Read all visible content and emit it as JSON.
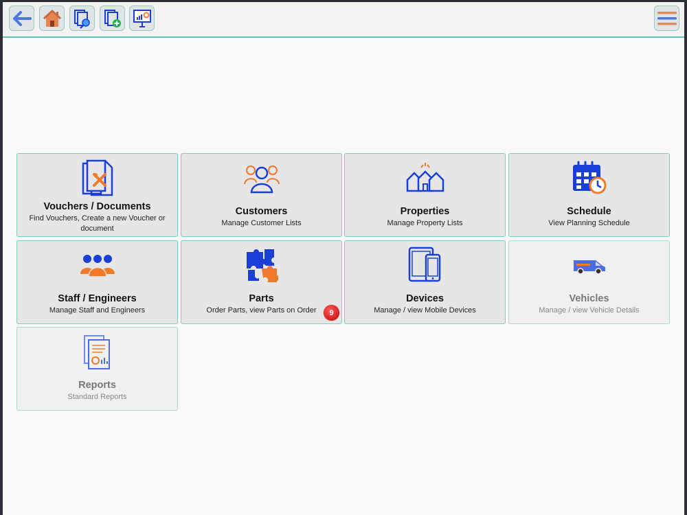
{
  "toolbar": {
    "buttons": [
      {
        "icon": "back-arrow-icon"
      },
      {
        "icon": "home-icon"
      },
      {
        "icon": "find-document-icon"
      },
      {
        "icon": "new-document-icon"
      },
      {
        "icon": "dashboard-presentation-icon"
      },
      {
        "icon": "hamburger-menu-icon"
      }
    ]
  },
  "tiles": [
    {
      "title": "Vouchers / Documents",
      "subtitle": "Find Vouchers, Create a new Voucher or document",
      "icon": "vouchers-documents-icon",
      "enabled": true
    },
    {
      "title": "Customers",
      "subtitle": "Manage Customer Lists",
      "icon": "customers-icon",
      "enabled": true
    },
    {
      "title": "Properties",
      "subtitle": "Manage Property Lists",
      "icon": "properties-icon",
      "enabled": true
    },
    {
      "title": "Schedule",
      "subtitle": "View Planning Schedule",
      "icon": "schedule-calendar-icon",
      "enabled": true
    },
    {
      "title": "Staff / Engineers",
      "subtitle": "Manage Staff and Engineers",
      "icon": "staff-group-icon",
      "enabled": true
    },
    {
      "title": "Parts",
      "subtitle": "Order Parts, view Parts on Order",
      "icon": "parts-puzzle-icon",
      "enabled": true,
      "badge": "9"
    },
    {
      "title": "Devices",
      "subtitle": "Manage / view Mobile Devices",
      "icon": "mobile-devices-icon",
      "enabled": true
    },
    {
      "title": "Vehicles",
      "subtitle": "Manage / view Vehicle Details",
      "icon": "van-icon",
      "enabled": false
    },
    {
      "title": "Reports",
      "subtitle": "Standard Reports",
      "icon": "reports-icon",
      "enabled": false
    }
  ],
  "colors": {
    "accent_teal": "#5cc2b3",
    "icon_blue": "#1a3fd6",
    "icon_orange": "#f07a2a",
    "badge_red": "#d40000"
  }
}
